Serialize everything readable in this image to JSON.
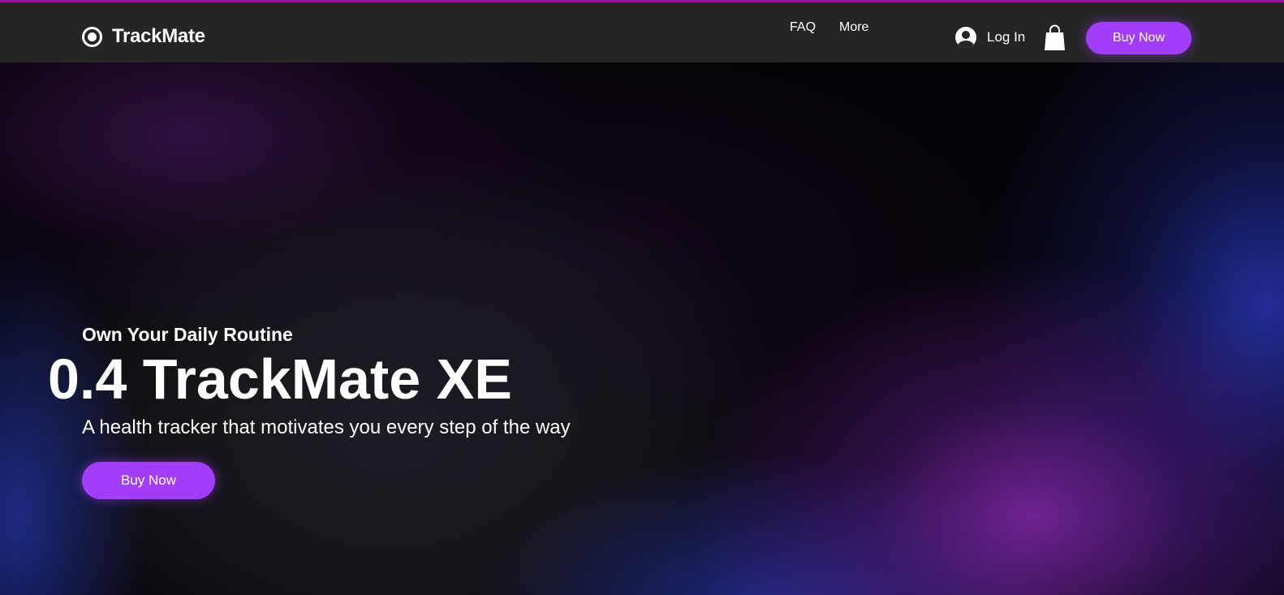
{
  "header": {
    "logo_text": "TrackMate",
    "logo_icon": "record-circle-icon",
    "nav": [
      {
        "label": "FAQ"
      },
      {
        "label": "More"
      }
    ],
    "login_label": "Log In",
    "login_icon": "user-avatar-icon",
    "cart_icon": "shopping-bag-icon",
    "buy_label": "Buy Now"
  },
  "hero": {
    "eyebrow": "Own Your Daily Routine",
    "title": "0.4 TrackMate XE",
    "subtitle": "A health tracker that motivates you every step of the way",
    "buy_label": "Buy Now"
  },
  "colors": {
    "accent_line": "#a3139d",
    "header_bg": "#252525",
    "button": "#a23dfc"
  }
}
